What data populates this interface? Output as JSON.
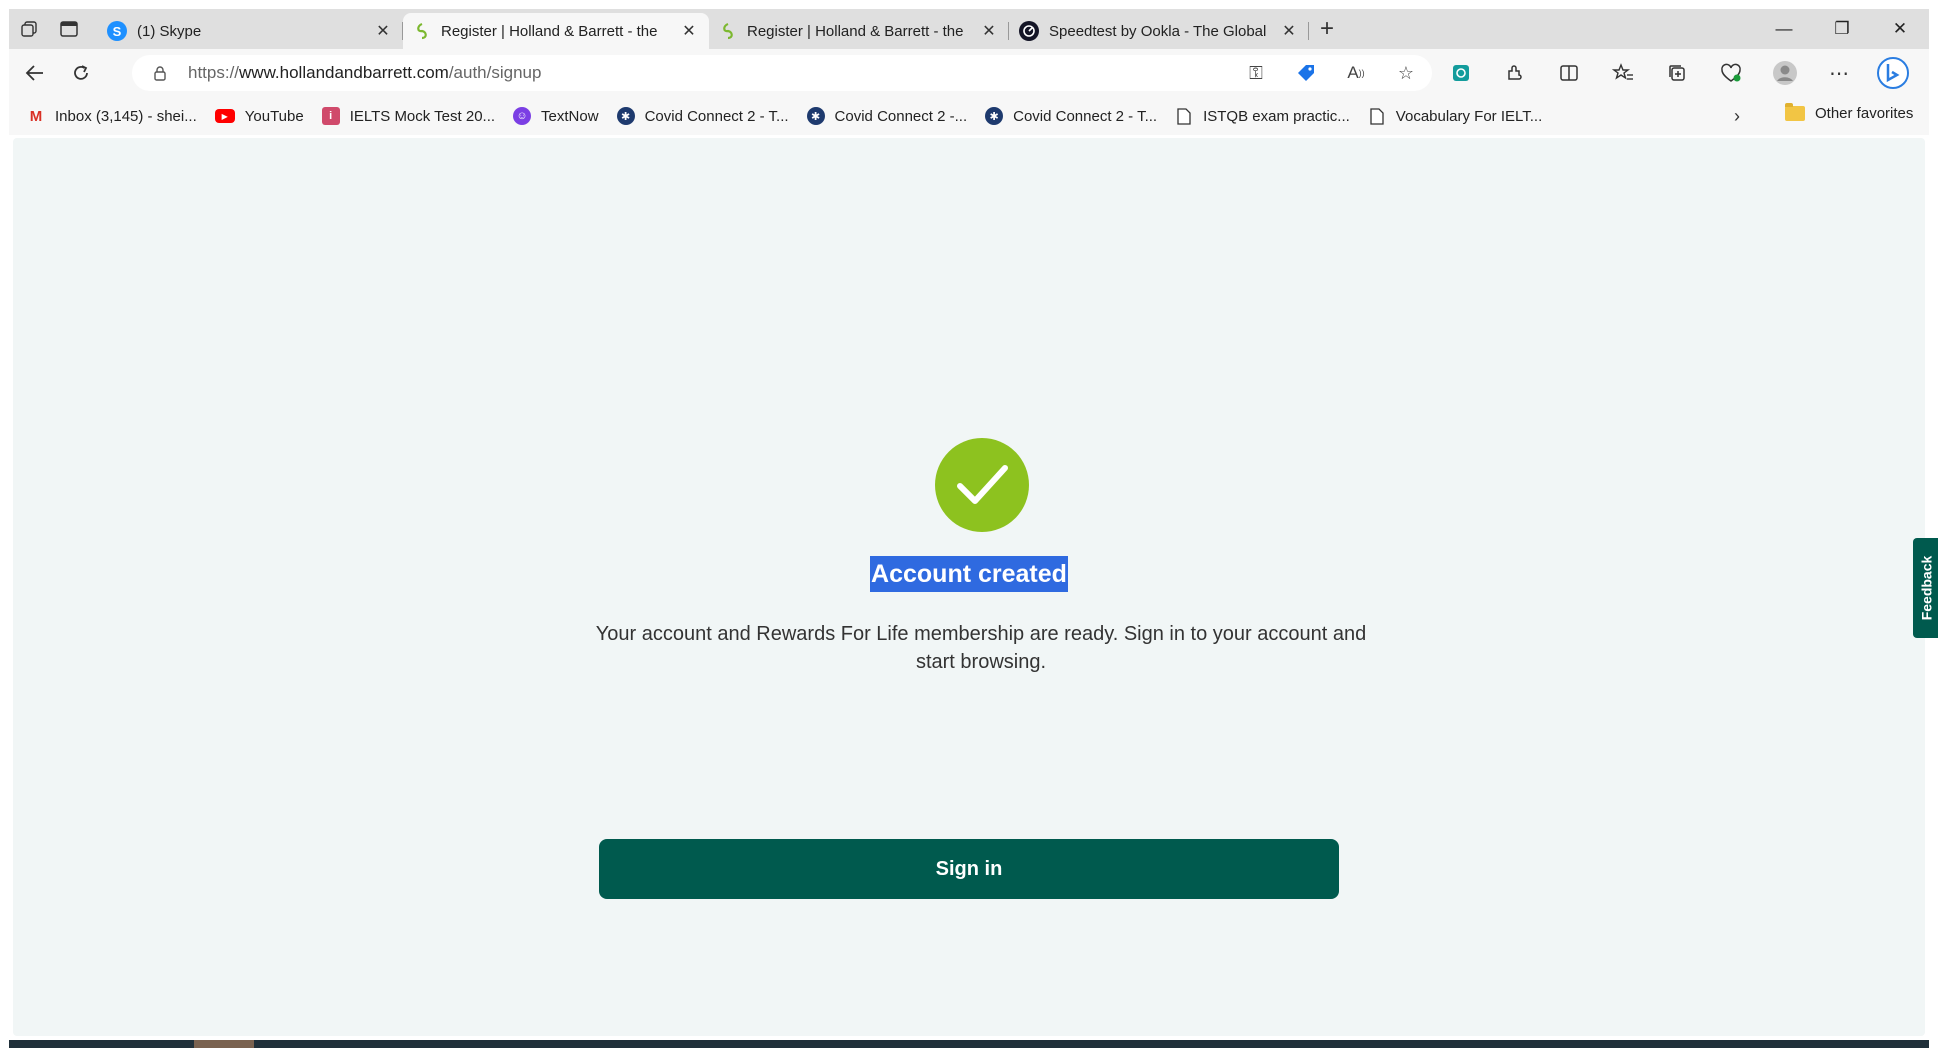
{
  "tabs": [
    {
      "title": "(1) Skype",
      "icon": "skype-icon",
      "active": false
    },
    {
      "title": "Register | Holland & Barrett - the",
      "icon": "holland-barrett-icon",
      "active": true
    },
    {
      "title": "Register | Holland & Barrett - the",
      "icon": "holland-barrett-icon",
      "active": false
    },
    {
      "title": "Speedtest by Ookla - The Global",
      "icon": "speedtest-icon",
      "active": false
    }
  ],
  "address": {
    "prefix": "https://",
    "host": "www.hollandandbarrett.com",
    "path": "/auth/signup"
  },
  "favorites": [
    {
      "label": "Inbox (3,145) - shei...",
      "icon": "gmail-icon",
      "color": "#d93025"
    },
    {
      "label": "YouTube",
      "icon": "youtube-icon",
      "color": "#ff0000"
    },
    {
      "label": "IELTS Mock Test 20...",
      "icon": "ielts-icon",
      "color": "#d04a6b"
    },
    {
      "label": "TextNow",
      "icon": "textnow-icon",
      "color": "#7b3fe4"
    },
    {
      "label": "Covid Connect 2 - T...",
      "icon": "covid-connect-icon",
      "color": "#1e3a6e"
    },
    {
      "label": "Covid Connect 2 -...",
      "icon": "covid-connect-icon",
      "color": "#1e3a6e"
    },
    {
      "label": "Covid Connect 2 - T...",
      "icon": "covid-connect-icon",
      "color": "#1e3a6e"
    },
    {
      "label": "ISTQB exam practic...",
      "icon": "page-icon",
      "color": "#ffffff"
    },
    {
      "label": "Vocabulary For IELT...",
      "icon": "page-icon",
      "color": "#ffffff"
    }
  ],
  "other_favorites": "Other favorites",
  "page": {
    "heading": "Account created",
    "description": "Your account and Rewards For Life membership are ready. Sign in to your account and start browsing.",
    "signin_label": "Sign in",
    "feedback_label": "Feedback",
    "colors": {
      "accent": "#005a4e",
      "check": "#8dc21f",
      "selection": "#2f6ae0"
    }
  }
}
